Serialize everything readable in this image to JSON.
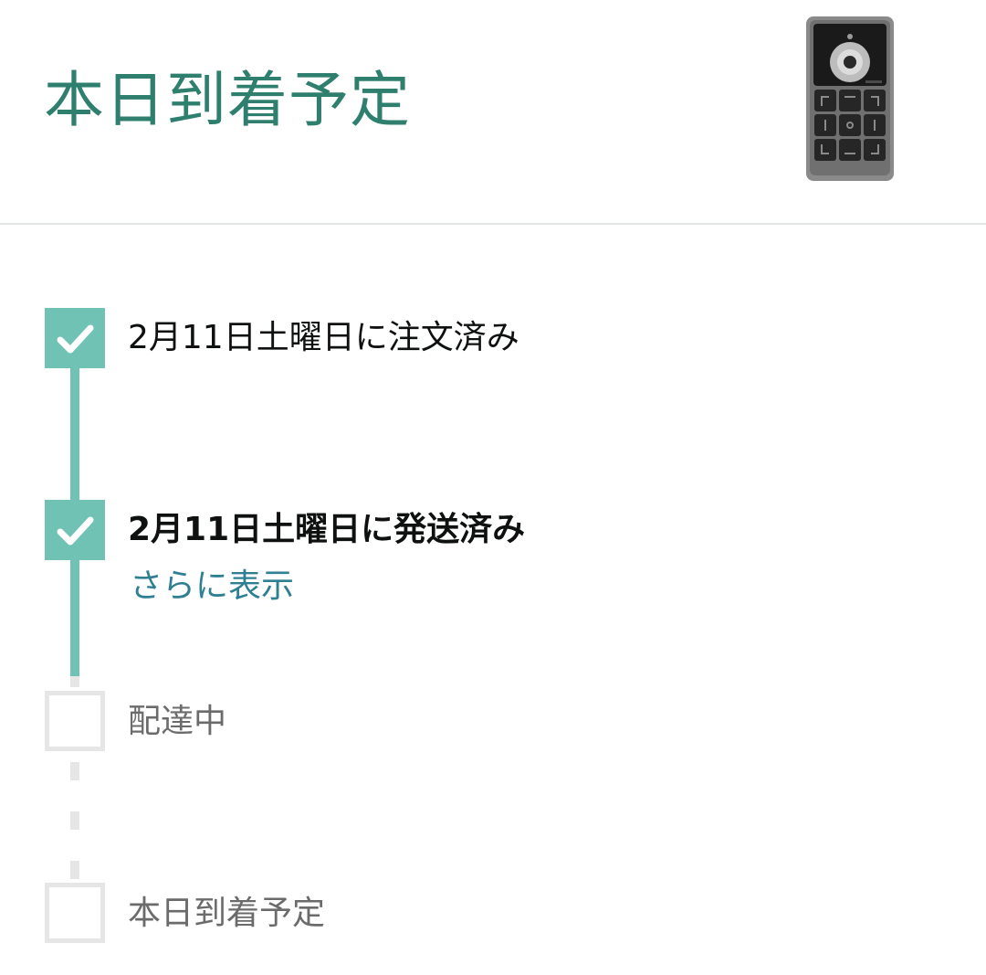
{
  "header": {
    "title": "本日到着予定",
    "product_image_icon": "remote-keypad-device-icon"
  },
  "timeline": {
    "steps": [
      {
        "label": "2月11日土曜日に注文済み",
        "state": "done"
      },
      {
        "label": "2月11日土曜日に発送済み",
        "state": "current"
      },
      {
        "label": "配達中",
        "state": "pending"
      },
      {
        "label": "本日到着予定",
        "state": "pending"
      }
    ],
    "more_link": "さらに表示",
    "check_icon": "checkmark-icon"
  },
  "colors": {
    "title": "#2f7f6f",
    "accent": "#6fc2b4",
    "link": "#2f7f93",
    "pending_line": "#e6e6e6"
  }
}
